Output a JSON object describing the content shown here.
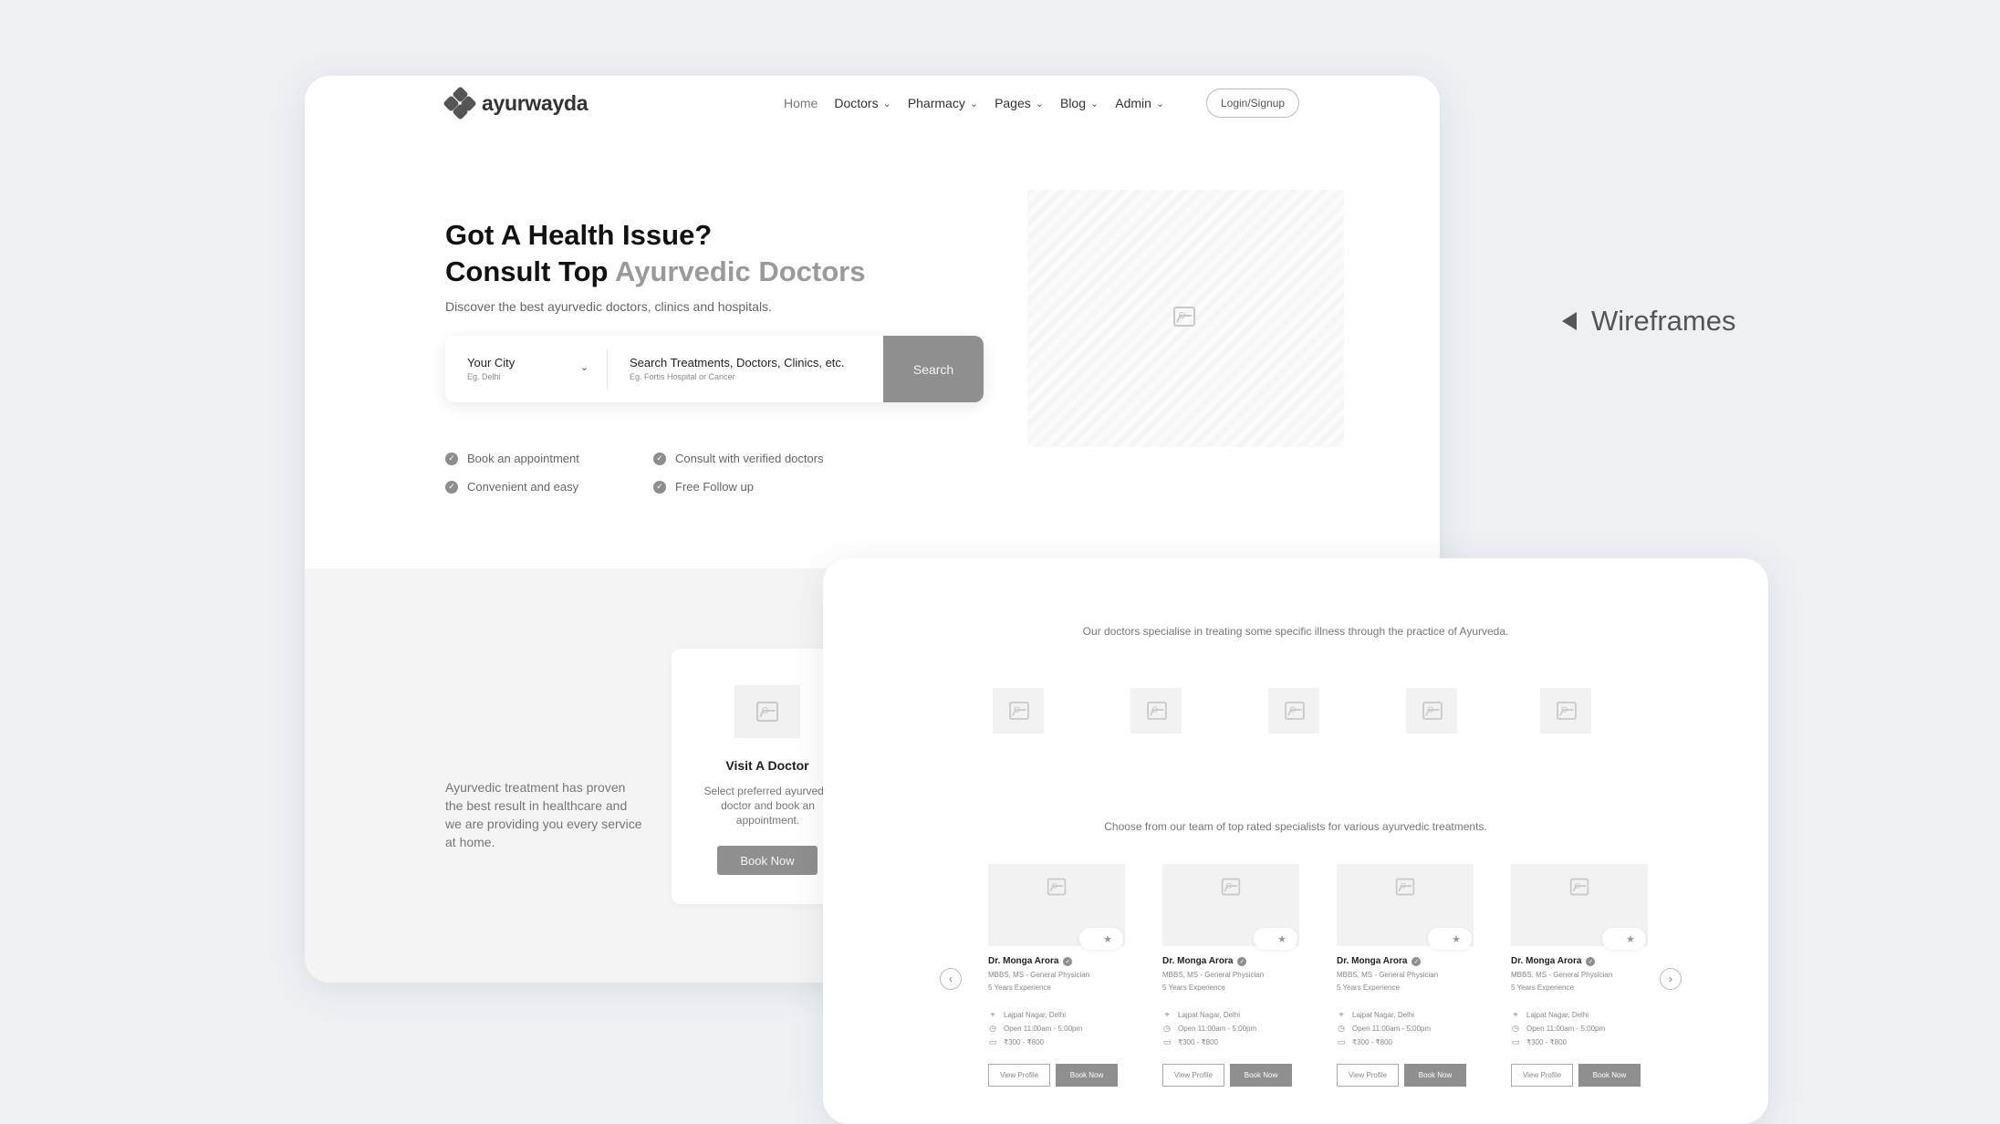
{
  "brand": {
    "name": "ayurwayda"
  },
  "nav": {
    "home": "Home",
    "items": [
      "Doctors",
      "Pharmacy",
      "Pages",
      "Blog",
      "Admin"
    ],
    "login": "Login/Signup"
  },
  "hero": {
    "title_line1": "Got A Health Issue?",
    "title_line2_prefix": "Consult Top ",
    "title_line2_accent": "Ayurvedic Doctors",
    "subtitle": "Discover the best ayurvedic doctors, clinics and hospitals.",
    "city_label": "Your City",
    "city_hint": "Eg. Delhi",
    "query_label": "Search Treatments, Doctors, Clinics, etc.",
    "query_hint": "Eg. Fortis Hospital or Cancer",
    "search_button": "Search",
    "features": [
      "Book an appointment",
      "Consult with verified doctors",
      "Convenient and easy",
      "Free Follow up"
    ]
  },
  "about": {
    "text": "Ayurvedic treatment has proven the best result in healthcare and we are providing you every service at home."
  },
  "visit": {
    "title": "Visit A Doctor",
    "description": "Select preferred ayurvedic doctor and book an appointment.",
    "button": "Book Now"
  },
  "side_label": "Wireframes",
  "specialities": {
    "text": "Our doctors specialise in treating some specific illness through the practice of Ayurveda."
  },
  "team": {
    "text": "Choose from our team of top rated specialists for various ayurvedic treatments.",
    "doctors": [
      {
        "name": "Dr. Monga Arora",
        "degree": "MBBS, MS - General Physician",
        "experience": "5 Years Experience",
        "location": "Lajpat Nagar, Delhi",
        "hours": "Open 11:00am - 5:00pm",
        "fee": "₹300 - ₹800",
        "view": "View Profile",
        "book": "Book Now"
      },
      {
        "name": "Dr. Monga Arora",
        "degree": "MBBS, MS - General Physician",
        "experience": "5 Years Experience",
        "location": "Lajpat Nagar, Delhi",
        "hours": "Open 11:00am - 5:00pm",
        "fee": "₹300 - ₹800",
        "view": "View Profile",
        "book": "Book Now"
      },
      {
        "name": "Dr. Monga Arora",
        "degree": "MBBS, MS - General Physician",
        "experience": "5 Years Experience",
        "location": "Lajpat Nagar, Delhi",
        "hours": "Open 11:00am - 5:00pm",
        "fee": "₹300 - ₹800",
        "view": "View Profile",
        "book": "Book Now"
      },
      {
        "name": "Dr. Monga Arora",
        "degree": "MBBS, MS - General Physician",
        "experience": "5 Years Experience",
        "location": "Lajpat Nagar, Delhi",
        "hours": "Open 11:00am - 5:00pm",
        "fee": "₹300 - ₹800",
        "view": "View Profile",
        "book": "Book Now"
      }
    ]
  }
}
